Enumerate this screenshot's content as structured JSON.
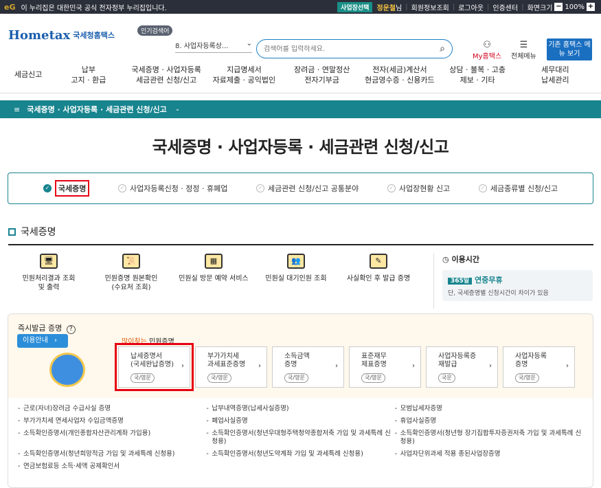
{
  "topbar": {
    "notice": "이 누리집은 대한민국 공식 전자정부 누리집입니다.",
    "auth_badge": "사업장선택",
    "user_name": "정운철",
    "user_suffix": "님",
    "links": [
      "회원정보조회",
      "로그아웃",
      "인증센터",
      "화면크기"
    ],
    "zoom": "100%"
  },
  "header": {
    "logo_text": "Hometax",
    "logo_sub": "국세청홈택스",
    "popular_badge": "인기검색어",
    "popular_select": "8. 사업자등록상...",
    "search_placeholder": "검색어를 입력하세요.",
    "my_home": "My홈택스",
    "all_menu": "전체메뉴",
    "old_home": "기존 홈택스 메뉴 보기"
  },
  "gnb": [
    "세금신고",
    "납부\n고지 · 환급",
    "국세증명 · 사업자등록\n세금관련 신청/신고",
    "지급명세서\n자료제출 · 공익법인",
    "장려금 · 연말정산\n전자기부금",
    "전자(세금)계산서\n현금영수증 · 신용카드",
    "상담 · 불복 · 고충\n제보 · 기타",
    "세무대리\n납세관리"
  ],
  "breadcrumb": "국세증명 · 사업자등록 · 세금관련 신청/신고",
  "page_title": "국세증명 · 사업자등록 · 세금관련 신청/신고",
  "tabs": [
    {
      "label": "국세증명",
      "active": true
    },
    {
      "label": "사업자등록신청 · 정정 · 휴폐업",
      "active": false
    },
    {
      "label": "세금관련 신청/신고 공통분야",
      "active": false
    },
    {
      "label": "사업장현황 신고",
      "active": false
    },
    {
      "label": "세금종류별 신청/신고",
      "active": false
    }
  ],
  "section_title": "국세증명",
  "services": [
    "민원처리결과 조회\n및 출력",
    "민원증명 원본확인\n(수요처 조회)",
    "민원실 방문 예약 서비스",
    "민원실 대기인원 조회",
    "사실확인 후 발급 증명"
  ],
  "usetime": {
    "title": "이용시간",
    "badge": "365일",
    "nonstop": "연중무휴",
    "note": "단, 국세증명별 신청시간이 차이가 있음"
  },
  "quick": {
    "title": "즉시발급 증명",
    "guide_button": "이용안내",
    "popular_prefix": "많이찾는",
    "popular_suffix": " 민원증명",
    "cards": [
      {
        "line1": "납세증명서",
        "line2": "(국세완납증명)",
        "tag": "국/영문"
      },
      {
        "line1": "부가가치세",
        "line2": "과세표준증명",
        "tag": "국/영문"
      },
      {
        "line1": "소득금액",
        "line2": "증명",
        "tag": "국/영문"
      },
      {
        "line1": "표준재무",
        "line2": "제표증명",
        "tag": "국/영문"
      },
      {
        "line1": "사업자등록증",
        "line2": "재발급",
        "tag": "국문"
      },
      {
        "line1": "사업자등록",
        "line2": "증명",
        "tag": "국/영문"
      }
    ],
    "list": [
      [
        "근로(자녀)장려금 수급사실 증명",
        "납부내역증명(납세사실증명)",
        "모범납세자증명"
      ],
      [
        "부가가치세 면세사업자 수입금액증명",
        "폐업사실증명",
        "휴업사실증명"
      ],
      [
        "소득확인증명서(개인종합자산관리계좌 가입용)",
        "소득확인증명서(청년우대형주택청약종합저축 가입 및 과세특례 신청용)",
        "소득확인증명서(청년형 장기집합투자증권저축 가입 및 과세특례 신청용)"
      ],
      [
        "소득확인증명서(청년희망적금 가입 및 과세특례 신청용)",
        "소득확인증명서(청년도약계좌 가입 및 과세특례 신청용)",
        "사업자단위과세 적용 종된사업장증명"
      ],
      [
        "연금보험료등 소득·세액 공제확인서",
        "",
        ""
      ]
    ]
  }
}
